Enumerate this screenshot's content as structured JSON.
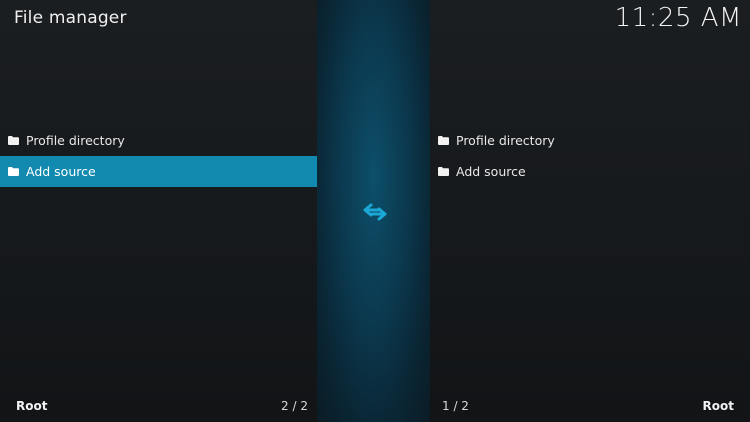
{
  "header": {
    "title": "File manager",
    "clock": "11:25 AM"
  },
  "left_pane": {
    "items": [
      {
        "label": "Profile directory",
        "icon": "folder-icon",
        "selected": false
      },
      {
        "label": "Add source",
        "icon": "folder-icon",
        "selected": true
      }
    ],
    "footer_label": "Root",
    "footer_count": "2 / 2"
  },
  "divider": {
    "icon": "swap-arrows-icon"
  },
  "right_pane": {
    "items": [
      {
        "label": "Profile directory",
        "icon": "folder-icon",
        "selected": false
      },
      {
        "label": "Add source",
        "icon": "folder-icon",
        "selected": false
      }
    ],
    "footer_label": "Root",
    "footer_count": "1 / 2"
  },
  "colors": {
    "selection": "#128ab0",
    "accent_icon": "#1aa7d6",
    "background": "#16191c"
  }
}
